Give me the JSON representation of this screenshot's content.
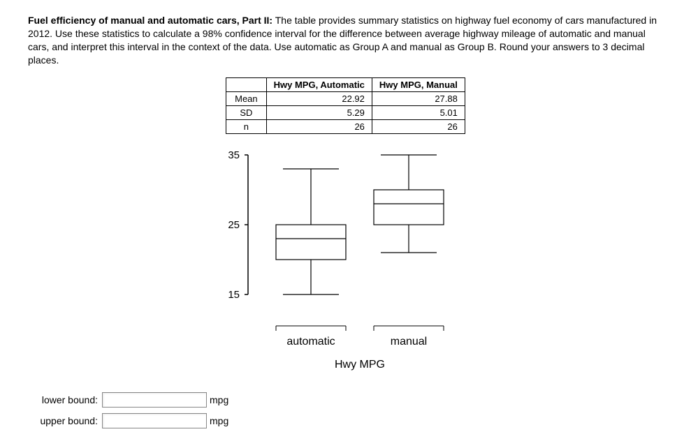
{
  "question": {
    "title": "Fuel efficiency of manual and automatic cars, Part II:",
    "body": "The table provides summary statistics on highway fuel economy of cars manufactured in 2012. Use these statistics to calculate a 98% confidence interval for the difference between average highway mileage of automatic and manual cars, and interpret this interval in the context of the data. Use automatic as Group A and manual as Group B. Round your answers to 3 decimal places."
  },
  "table": {
    "headers": {
      "col1": "Hwy MPG, Automatic",
      "col2": "Hwy MPG, Manual"
    },
    "rows": {
      "mean": {
        "label": "Mean",
        "auto": "22.92",
        "manual": "27.88"
      },
      "sd": {
        "label": "SD",
        "auto": "5.29",
        "manual": "5.01"
      },
      "n": {
        "label": "n",
        "auto": "26",
        "manual": "26"
      }
    }
  },
  "chart_data": {
    "type": "boxplot",
    "title": "Hwy MPG",
    "xlabel": "Hwy MPG",
    "ylabel": "",
    "ylim": [
      15,
      35
    ],
    "yticks": [
      15,
      25,
      35
    ],
    "categories": [
      "automatic",
      "manual"
    ],
    "series": [
      {
        "name": "automatic",
        "min": 15,
        "q1": 20,
        "median": 23,
        "q3": 25,
        "max": 33
      },
      {
        "name": "manual",
        "min": 21,
        "q1": 25,
        "median": 28,
        "q3": 30,
        "max": 35
      }
    ]
  },
  "answers": {
    "lower": {
      "label": "lower bound:",
      "value": "",
      "unit": "mpg"
    },
    "upper": {
      "label": "upper bound:",
      "value": "",
      "unit": "mpg"
    }
  }
}
